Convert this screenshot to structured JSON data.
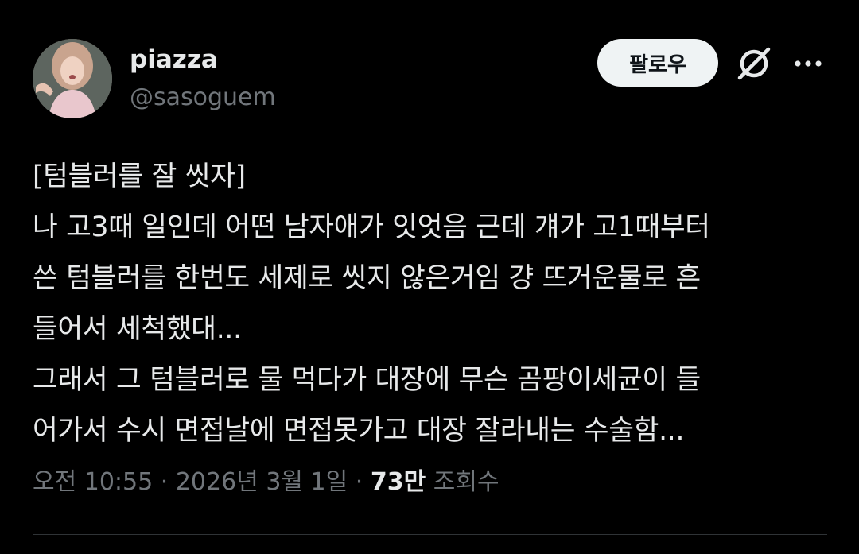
{
  "author": {
    "display_name": "piazza",
    "handle": "@sasoguem"
  },
  "actions": {
    "follow_label": "팔로우",
    "grok_icon": "grok-icon",
    "more_icon": "more-icon"
  },
  "tweet": {
    "lines": [
      "[텀블러를 잘 씻자]",
      "나 고3때 일인데 어떤 남자애가 잇엇음 근데 걔가 고1때부터",
      "쓴 텀블러를 한번도 세제로 씻지 않은거임 걍 뜨거운물로 흔",
      "들어서 세척했대...",
      "그래서 그 텀블러로 물 먹다가 대장에 무슨 곰팡이세균이 들",
      "어가서 수시 면접날에 면접못가고 대장 잘라내는 수술함..."
    ]
  },
  "meta": {
    "time": "오전 10:55",
    "separator": "·",
    "date": "2026년 3월 1일",
    "views_count": "73만",
    "views_label": "조회수"
  },
  "colors": {
    "background": "#000000",
    "text_primary": "#e7e9ea",
    "text_secondary": "#71767b",
    "button_bg": "#eff3f4",
    "button_text": "#0f1419",
    "divider": "#2f3336"
  }
}
